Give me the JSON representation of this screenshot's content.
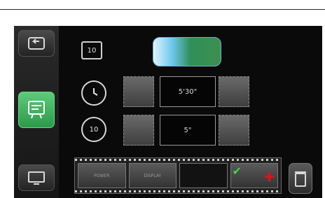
{
  "display": {
    "mode_label": "10",
    "timer_value": "5'30\"",
    "repeat_icon_label": "10",
    "repeat_value": "5\"",
    "film_labels": [
      "POWER",
      "DISPLAY"
    ]
  },
  "icons": {
    "back": "back-arrow-icon",
    "menu": "menu-icon",
    "clock": "clock-icon",
    "repeat": "repeat-icon",
    "tv": "tv-icon",
    "trash": "trash-icon",
    "check": "check-icon",
    "target": "target-icon"
  },
  "colors": {
    "accent_green": "#2c9a4a",
    "check_green": "#4bd04b",
    "target_red": "#d21818"
  }
}
